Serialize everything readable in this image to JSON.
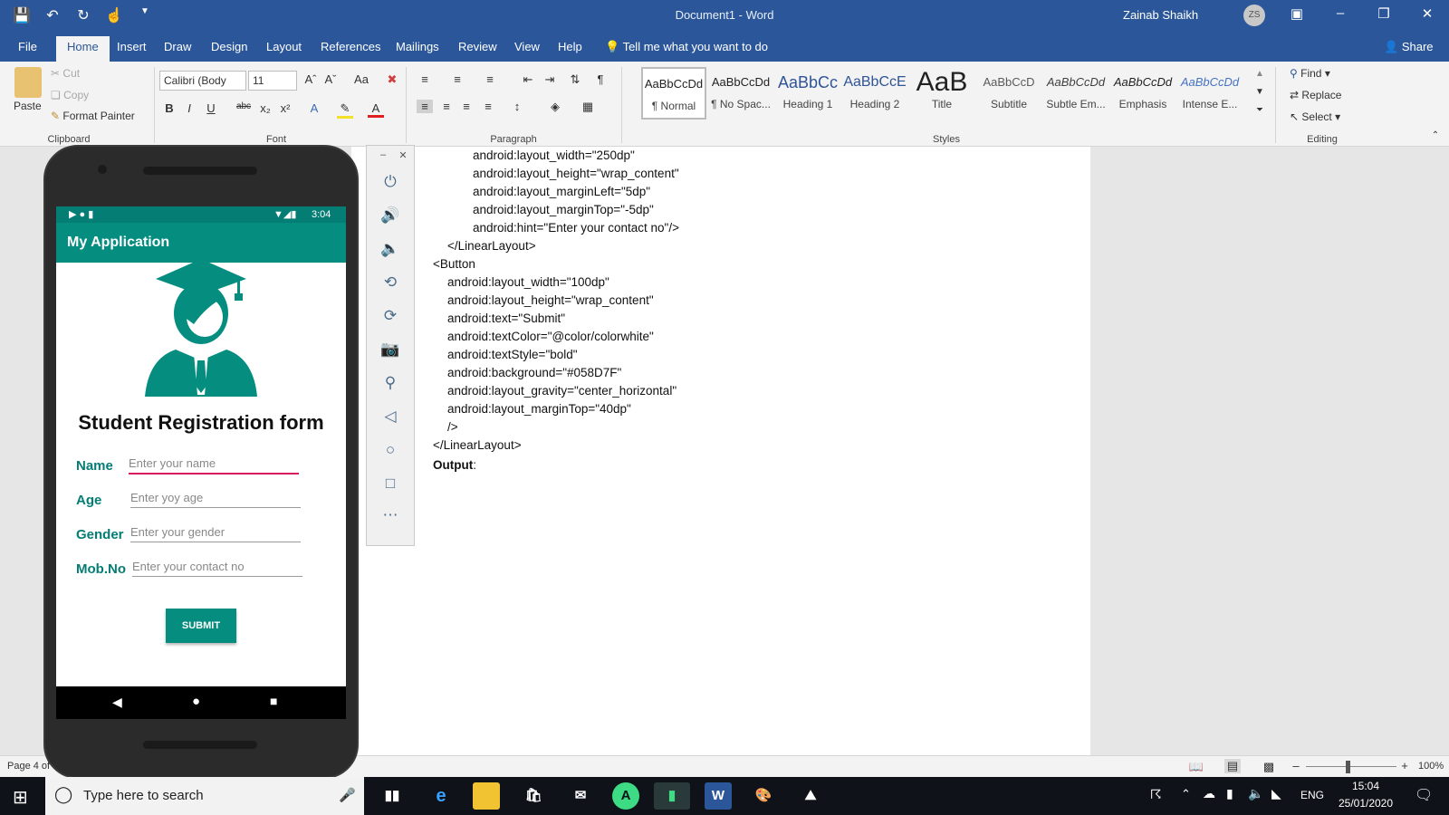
{
  "titlebar": {
    "doc_title": "Document1 - Word",
    "user": "Zainab Shaikh",
    "user_initials": "ZS"
  },
  "tabs": [
    "File",
    "Home",
    "Insert",
    "Draw",
    "Design",
    "Layout",
    "References",
    "Mailings",
    "Review",
    "View",
    "Help"
  ],
  "tell_me": "Tell me what you want to do",
  "share": "Share",
  "clipboard": {
    "paste": "Paste",
    "cut": "Cut",
    "copy": "Copy",
    "format_painter": "Format Painter",
    "label": "Clipboard"
  },
  "font": {
    "name": "Calibri (Body",
    "size": "11",
    "label": "Font"
  },
  "paragraph_label": "Paragraph",
  "styles": {
    "label": "Styles",
    "items": [
      {
        "preview": "AaBbCcDd",
        "name": "¶ Normal"
      },
      {
        "preview": "AaBbCcDd",
        "name": "¶ No Spac..."
      },
      {
        "preview": "AaBbCc",
        "name": "Heading 1"
      },
      {
        "preview": "AaBbCcE",
        "name": "Heading 2"
      },
      {
        "preview": "AaB",
        "name": "Title"
      },
      {
        "preview": "AaBbCcD",
        "name": "Subtitle"
      },
      {
        "preview": "AaBbCcDd",
        "name": "Subtle Em..."
      },
      {
        "preview": "AaBbCcDd",
        "name": "Emphasis"
      },
      {
        "preview": "AaBbCcDd",
        "name": "Intense E..."
      }
    ]
  },
  "editing": {
    "find": "Find",
    "replace": "Replace",
    "select": "Select",
    "label": "Editing"
  },
  "document_lines": [
    "android:layout_width=\"250dp\"",
    "android:layout_height=\"wrap_content\"",
    "android:layout_marginLeft=\"5dp\"",
    "android:layout_marginTop=\"-5dp\"",
    "android:hint=\"Enter your contact no\"/>",
    "</LinearLayout>",
    "<Button",
    "android:layout_width=\"100dp\"",
    "android:layout_height=\"wrap_content\"",
    "android:text=\"Submit\"",
    "android:textColor=\"@color/colorwhite\"",
    "android:textStyle=\"bold\"",
    "android:background=\"#058D7F\"",
    "android:layout_gravity=\"center_horizontal\"",
    "android:layout_marginTop=\"40dp\"",
    "/>",
    "</LinearLayout>"
  ],
  "output_label": "Output",
  "output_colon": ":",
  "statusbar": {
    "page": "Page 4 of",
    "zoom": "100%"
  },
  "taskbar": {
    "search_placeholder": "Type here to search",
    "lang": "ENG",
    "time": "15:04",
    "date": "25/01/2020"
  },
  "phone": {
    "time": "3:04",
    "app_title": "My Application",
    "form_title": "Student Registration form",
    "fields": [
      {
        "label": "Name",
        "hint": "Enter your name"
      },
      {
        "label": "Age",
        "hint": "Enter yoy age"
      },
      {
        "label": "Gender",
        "hint": "Enter your gender"
      },
      {
        "label": "Mob.No",
        "hint": "Enter your contact no"
      }
    ],
    "submit": "SUBMIT",
    "accent": "#058D7F"
  }
}
